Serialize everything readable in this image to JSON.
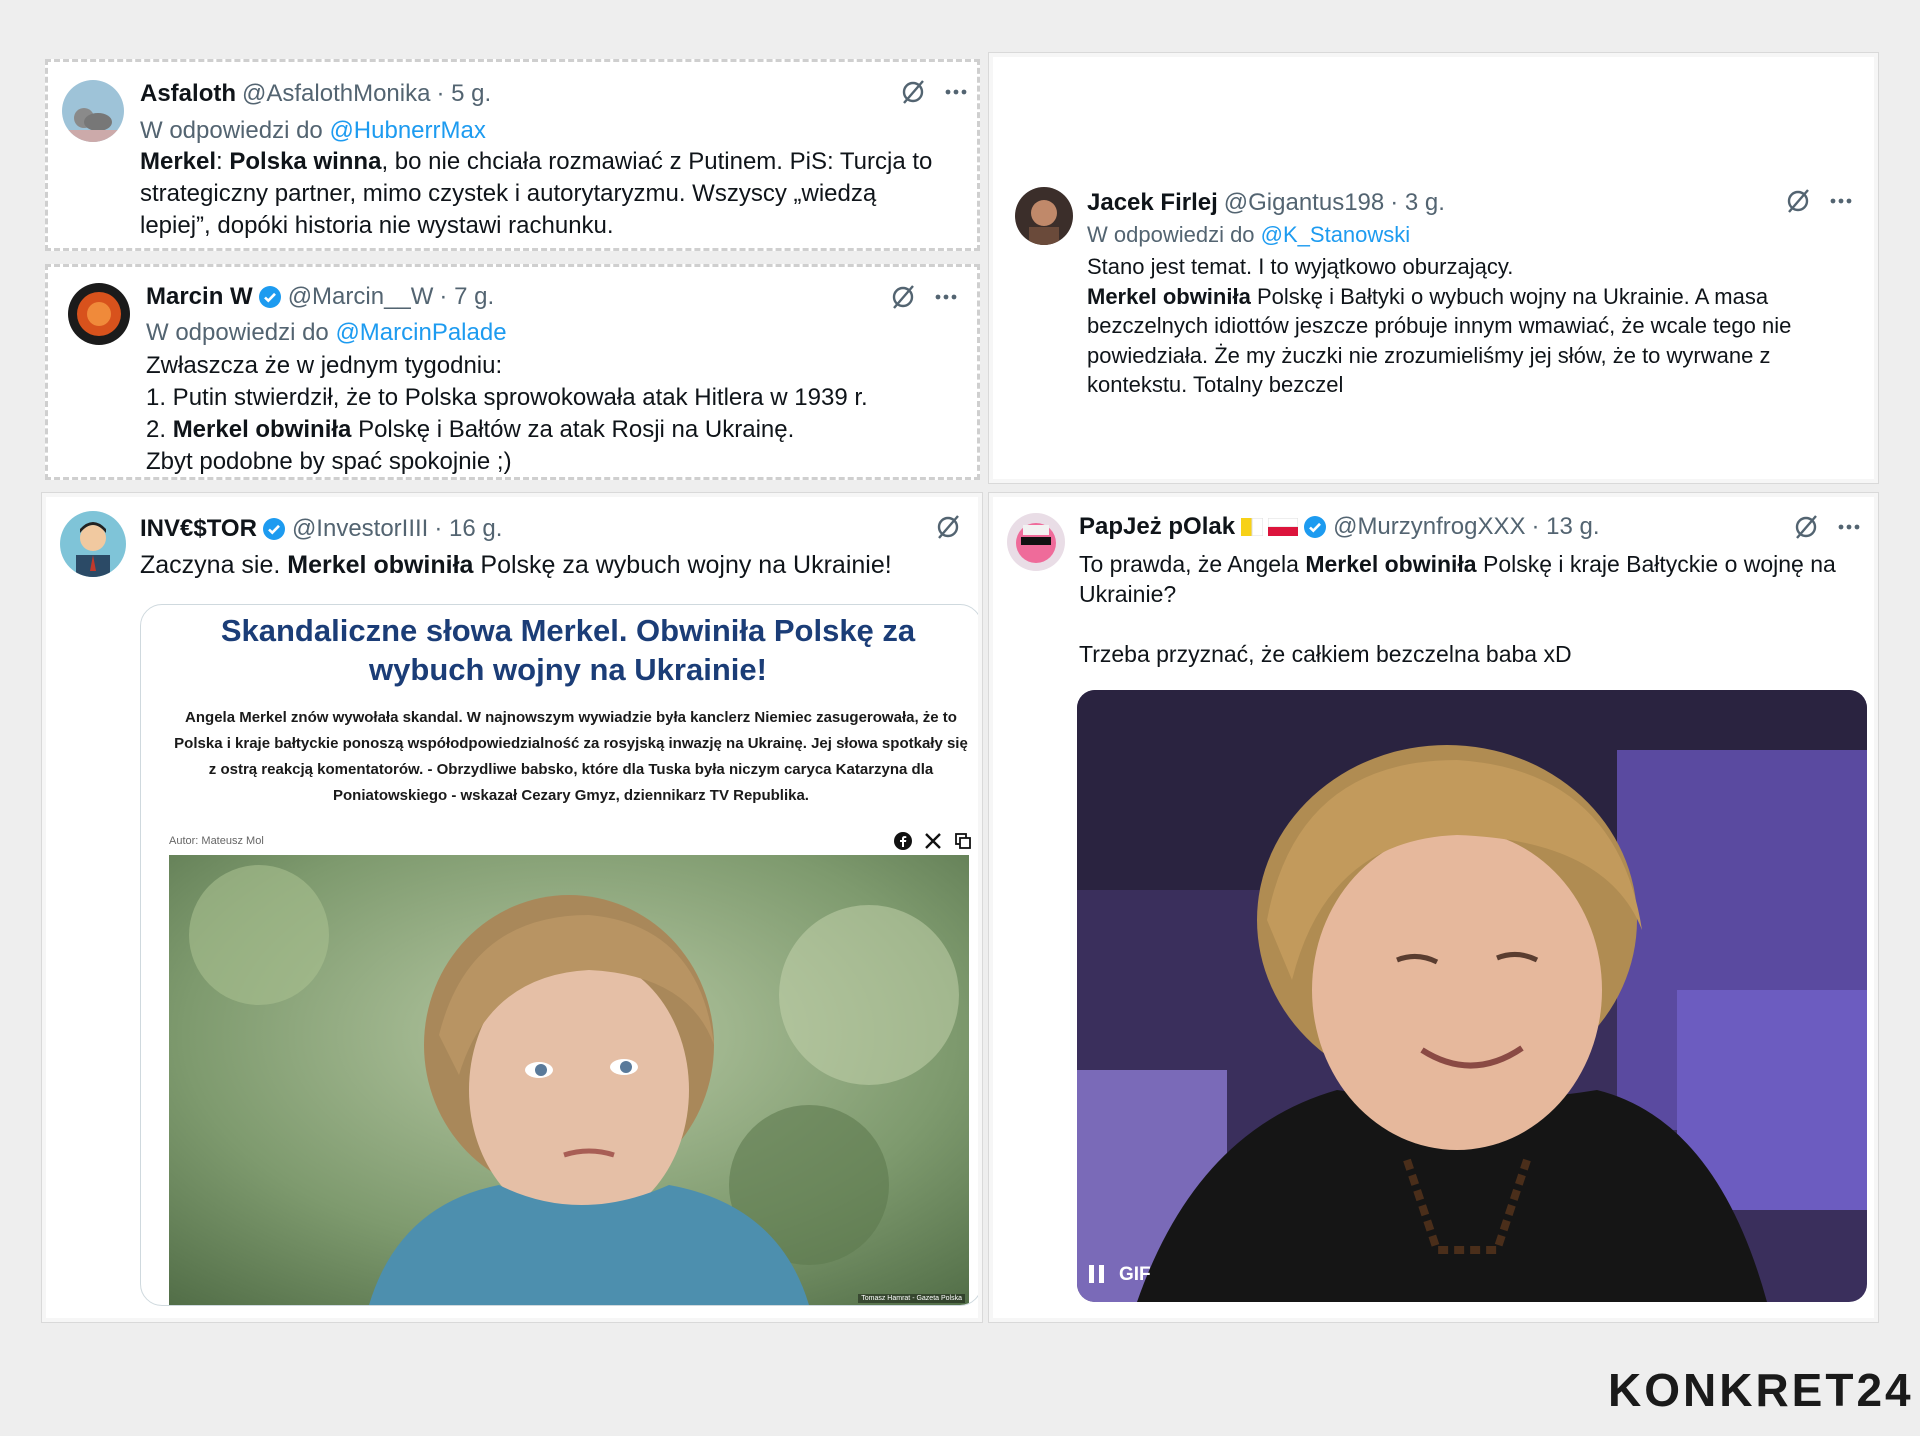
{
  "tweets": [
    {
      "name": "Asfaloth",
      "handle": "@AsfalothMonika",
      "time": "· 5 g.",
      "reply_prefix": "W odpowiedzi do",
      "reply_to": "@HubnerrMax",
      "text": {
        "b1": "Merkel",
        "t1": ": ",
        "b2": "Polska winna",
        "t2": ", bo nie chciała rozmawiać z Putinem. PiS: Turcja to strategiczny partner, mimo czystek i autorytaryzmu. Wszyscy „wiedzą lepiej”, dopóki historia nie wystawi rachunku."
      }
    },
    {
      "name": "Marcin W",
      "handle": "@Marcin__W",
      "time": "· 7 g.",
      "reply_prefix": "W odpowiedzi do",
      "reply_to": "@MarcinPalade",
      "text": {
        "l1": "Zwłaszcza że w jednym tygodniu:",
        "l2": "1. Putin stwierdził, że to Polska sprowokowała atak Hitlera w 1939 r.",
        "l3a": "2. ",
        "l3b": "Merkel obwiniła",
        "l3c": " Polskę i Bałtów za atak Rosji na Ukrainę.",
        "l4": "Zbyt podobne by spać spokojnie ;)"
      }
    },
    {
      "name": "Jacek Firlej",
      "handle": "@Gigantus198",
      "time": "· 3 g.",
      "reply_prefix": "W odpowiedzi do",
      "reply_to": "@K_Stanowski",
      "text": {
        "l1": "Stano jest temat. I to wyjątkowo oburzający.",
        "b1": "Merkel obwiniła",
        "t1": " Polskę i Bałtyki o wybuch wojny na Ukrainie. A masa bezczelnych idiottów jeszcze próbuje innym wmawiać, że wcale tego nie powiedziała. Że my żuczki nie zrozumieliśmy jej słów, że to wyrwane z kontekstu. Totalny bezczel"
      }
    },
    {
      "name": "INV€$TOR",
      "handle": "@InvestorIIII",
      "time": "· 16 g.",
      "text": {
        "t1": "Zaczyna sie. ",
        "b1": "Merkel obwiniła",
        "t2": " Polskę za wybuch wojny na Ukrainie!"
      },
      "article": {
        "title": "Skandaliczne słowa Merkel. Obwiniła Polskę za wybuch wojny na Ukrainie!",
        "lead": "Angela Merkel znów wywołała skandal. W najnowszym wywiadzie była kanclerz Niemiec zasugerowała, że to Polska i kraje bałtyckie ponoszą współodpowiedzialność za rosyjską inwazję na Ukrainę. Jej słowa spotkały się z ostrą reakcją komentatorów. - Obrzydliwe babsko, które dla Tuska była niczym caryca Katarzyna dla Poniatowskiego - wskazał Cezary Gmyz, dziennikarz TV Republika.",
        "author": "Autor: Mateusz Mol",
        "credit": "Tomasz Hamrat - Gazeta Polska"
      }
    },
    {
      "name": "PapJeż pOlak",
      "handle": "@MurzynfrogXXX",
      "time": "· 13 g.",
      "text": {
        "t1": "To prawda, że Angela ",
        "b1": "Merkel obwiniła",
        "t2": " Polskę i kraje Bałtyckie o wojnę na Ukrainie?",
        "l2": "Trzeba przyznać, że całkiem bezczelna baba xD"
      },
      "media_badge": "GIF"
    }
  ],
  "logo": "KONKRET24",
  "colors": {
    "link": "#1d9bf0",
    "verified": "#1d9bf0",
    "article_title": "#1b3d77"
  }
}
